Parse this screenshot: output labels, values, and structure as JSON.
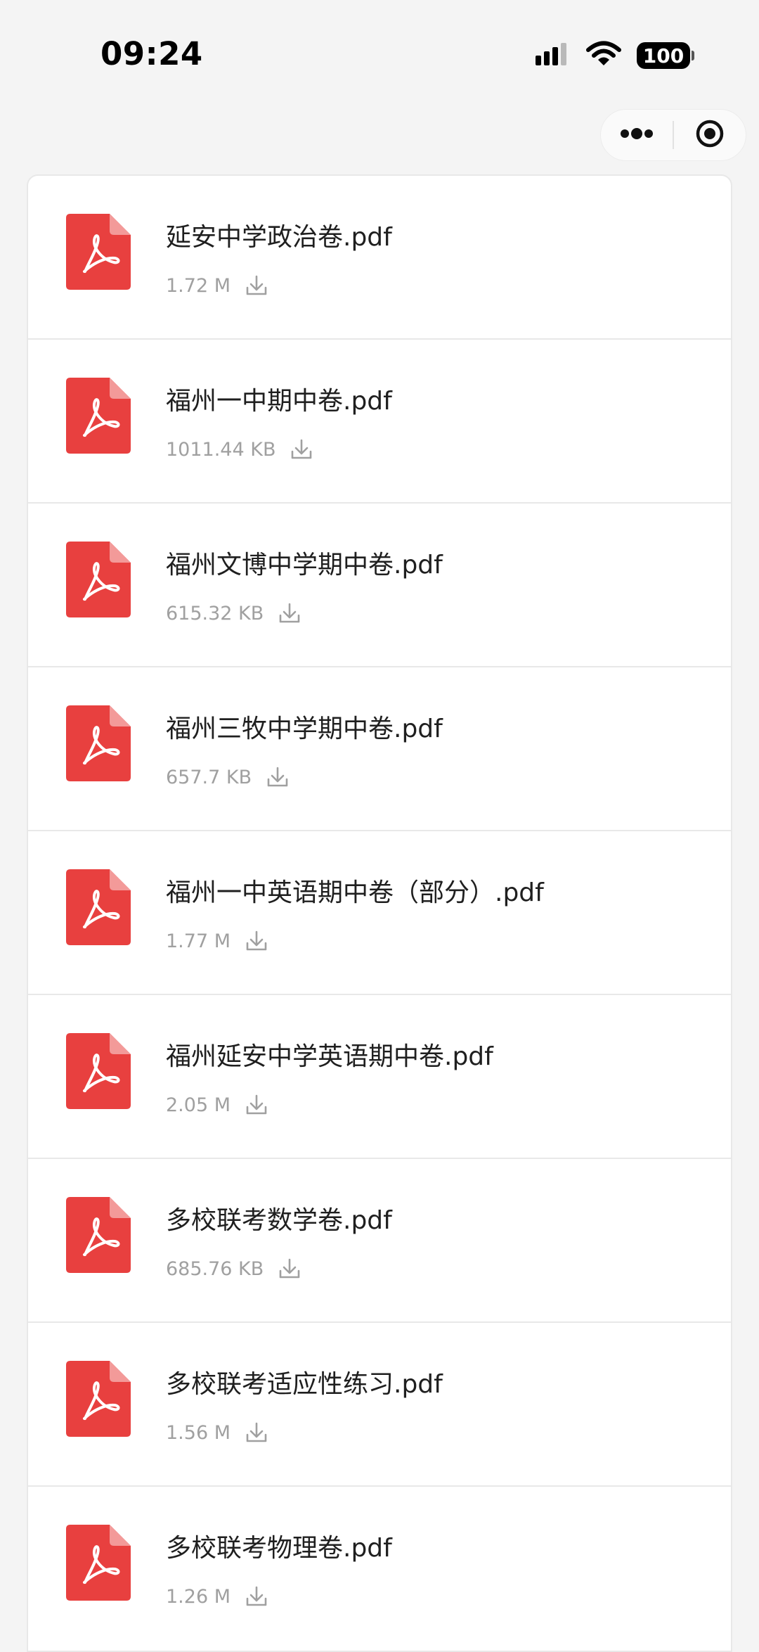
{
  "status_bar": {
    "time": "09:24",
    "battery": "100",
    "icons": [
      "signal-icon",
      "wifi-icon",
      "battery-icon"
    ]
  },
  "capsule": {
    "icons": [
      "more-icon",
      "close-target-icon"
    ]
  },
  "files": [
    {
      "name": "延安中学政治卷.pdf",
      "size": "1.72 M"
    },
    {
      "name": "福州一中期中卷.pdf",
      "size": "1011.44 KB"
    },
    {
      "name": "福州文博中学期中卷.pdf",
      "size": "615.32 KB"
    },
    {
      "name": "福州三牧中学期中卷.pdf",
      "size": "657.7 KB"
    },
    {
      "name": "福州一中英语期中卷（部分）.pdf",
      "size": "1.77 M"
    },
    {
      "name": "福州延安中学英语期中卷.pdf",
      "size": "2.05 M"
    },
    {
      "name": "多校联考数学卷.pdf",
      "size": "685.76 KB"
    },
    {
      "name": "多校联考适应性练习.pdf",
      "size": "1.56 M"
    },
    {
      "name": "多校联考物理卷.pdf",
      "size": "1.26 M"
    }
  ],
  "colors": {
    "pdf_red": "#e8403f",
    "pdf_fold": "#f39a99",
    "meta_gray": "#a0a0a0",
    "background": "#f4f4f4"
  }
}
